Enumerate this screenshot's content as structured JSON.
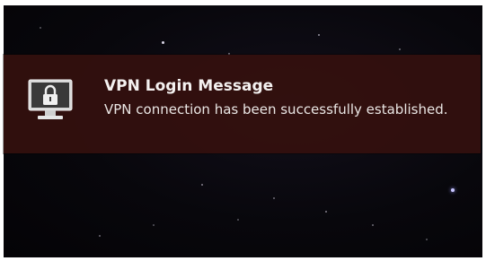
{
  "notification": {
    "icon": "lock-monitor-icon",
    "title": "VPN Login Message",
    "body": "VPN connection has been successfully established."
  },
  "colors": {
    "desktop_background": "#08070c",
    "notification_background": "#34100e",
    "text": "#f4f1f0"
  }
}
